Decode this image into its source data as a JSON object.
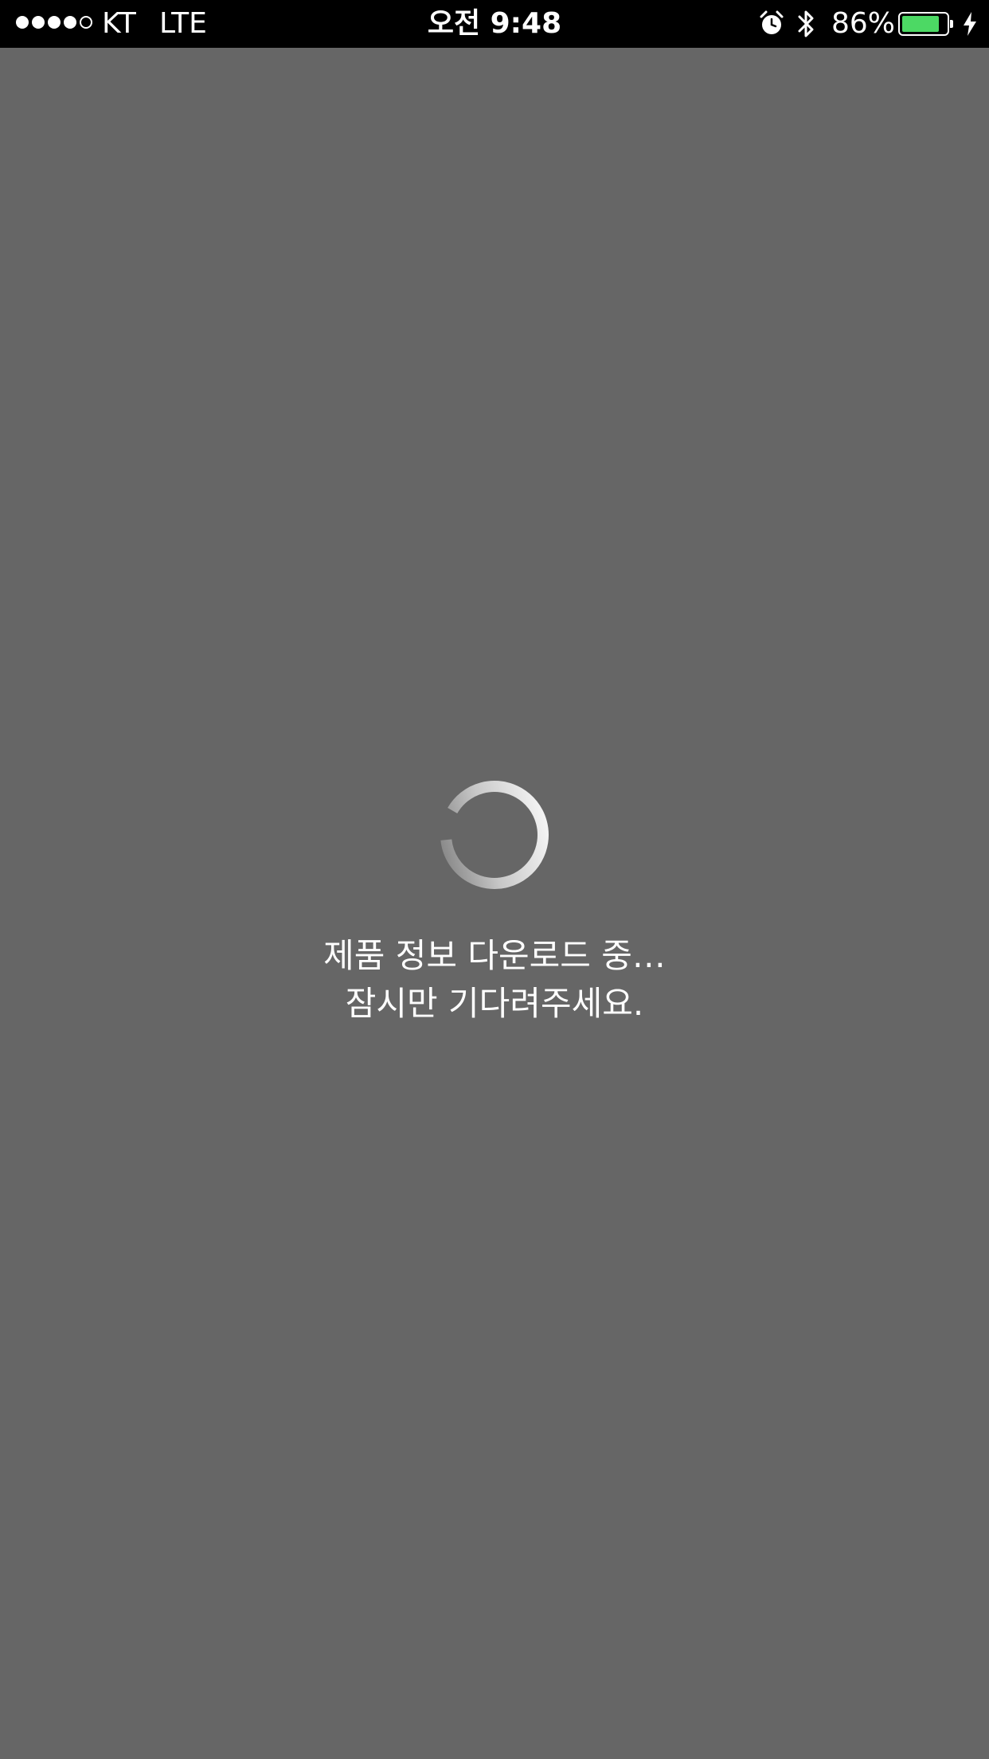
{
  "status_bar": {
    "signal_bars_filled": 4,
    "signal_bars_total": 5,
    "carrier": "KT",
    "network": "LTE",
    "time": "오전 9:48",
    "battery_percent": "86%",
    "battery_level": 0.86,
    "battery_color": "#4cd964",
    "icons": [
      "alarm-icon",
      "bluetooth-icon",
      "battery-icon",
      "charging-icon"
    ]
  },
  "loading": {
    "line1": "제품 정보 다운로드 중…",
    "line2": "잠시만 기다려주세요."
  },
  "colors": {
    "background": "#666666",
    "status_bar": "#000000",
    "text": "#ffffff"
  }
}
